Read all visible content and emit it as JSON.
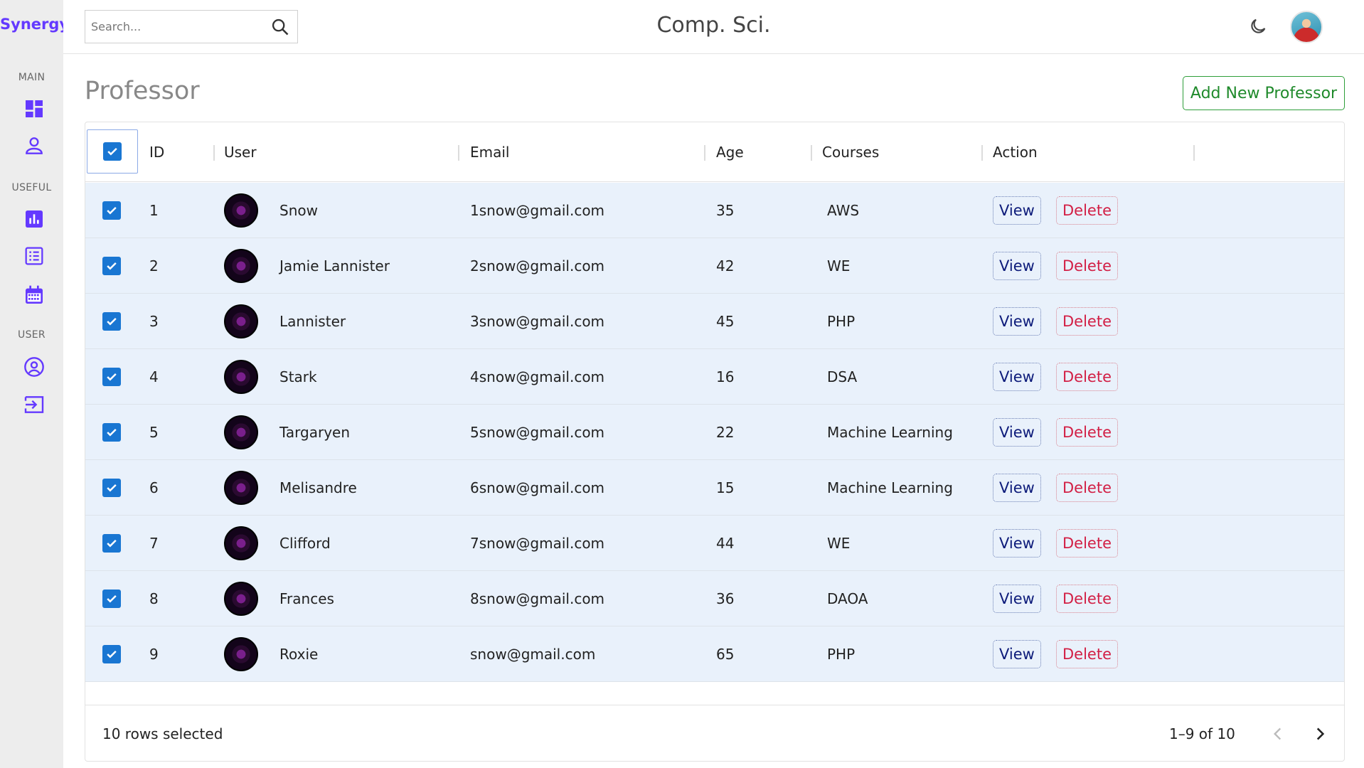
{
  "app": {
    "logo": "Synergy",
    "title": "Comp. Sci."
  },
  "search": {
    "placeholder": "Search..."
  },
  "sidebar": {
    "sections": [
      {
        "label": "MAIN",
        "items": [
          "dashboard-icon",
          "person-icon"
        ]
      },
      {
        "label": "USEFUL",
        "items": [
          "bar-chart-icon",
          "list-icon",
          "calendar-icon"
        ]
      },
      {
        "label": "USER",
        "items": [
          "account-circle-icon",
          "logout-icon"
        ]
      }
    ],
    "accent": "#6439ff"
  },
  "page": {
    "title": "Professor",
    "add_button": "Add New Professor"
  },
  "table": {
    "columns": [
      "ID",
      "User",
      "Email",
      "Age",
      "Courses",
      "Action"
    ],
    "rows": [
      {
        "id": "1",
        "user": "Snow",
        "email": "1snow@gmail.com",
        "age": "35",
        "course": "AWS"
      },
      {
        "id": "2",
        "user": "Jamie Lannister",
        "email": "2snow@gmail.com",
        "age": "42",
        "course": "WE"
      },
      {
        "id": "3",
        "user": "Lannister",
        "email": "3snow@gmail.com",
        "age": "45",
        "course": "PHP"
      },
      {
        "id": "4",
        "user": "Stark",
        "email": "4snow@gmail.com",
        "age": "16",
        "course": "DSA"
      },
      {
        "id": "5",
        "user": "Targaryen",
        "email": "5snow@gmail.com",
        "age": "22",
        "course": "Machine Learning"
      },
      {
        "id": "6",
        "user": "Melisandre",
        "email": "6snow@gmail.com",
        "age": "15",
        "course": "Machine Learning"
      },
      {
        "id": "7",
        "user": "Clifford",
        "email": "7snow@gmail.com",
        "age": "44",
        "course": "WE"
      },
      {
        "id": "8",
        "user": "Frances",
        "email": "8snow@gmail.com",
        "age": "36",
        "course": "DAOA"
      },
      {
        "id": "9",
        "user": "Roxie",
        "email": "snow@gmail.com",
        "age": "65",
        "course": "PHP"
      }
    ],
    "action_view": "View",
    "action_delete": "Delete"
  },
  "footer": {
    "selected": "10 rows selected",
    "range": "1–9 of 10"
  },
  "colors": {
    "checkbox": "#1976d2",
    "row_bg": "#e9f1fb",
    "add_button": "#2e9e3a",
    "view": "#0d1b7a",
    "delete": "#d21f45"
  }
}
